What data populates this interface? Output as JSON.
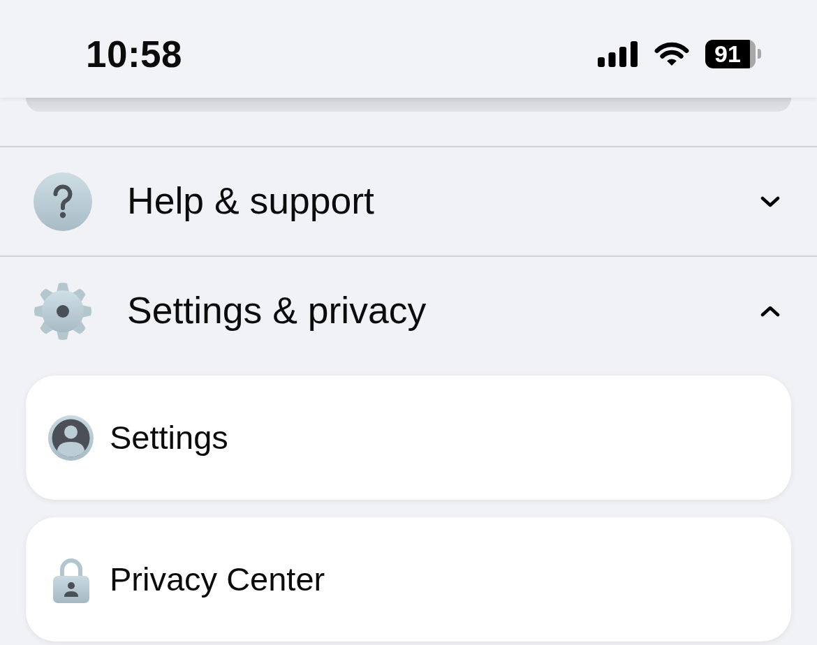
{
  "status_bar": {
    "time": "10:58",
    "battery": "91"
  },
  "sections": [
    {
      "kind": "help",
      "label": "Help & support",
      "expanded": false
    },
    {
      "kind": "gear",
      "label": "Settings & privacy",
      "expanded": true,
      "items": [
        {
          "kind": "profile",
          "label": "Settings"
        },
        {
          "kind": "lock",
          "label": "Privacy Center"
        }
      ]
    }
  ]
}
